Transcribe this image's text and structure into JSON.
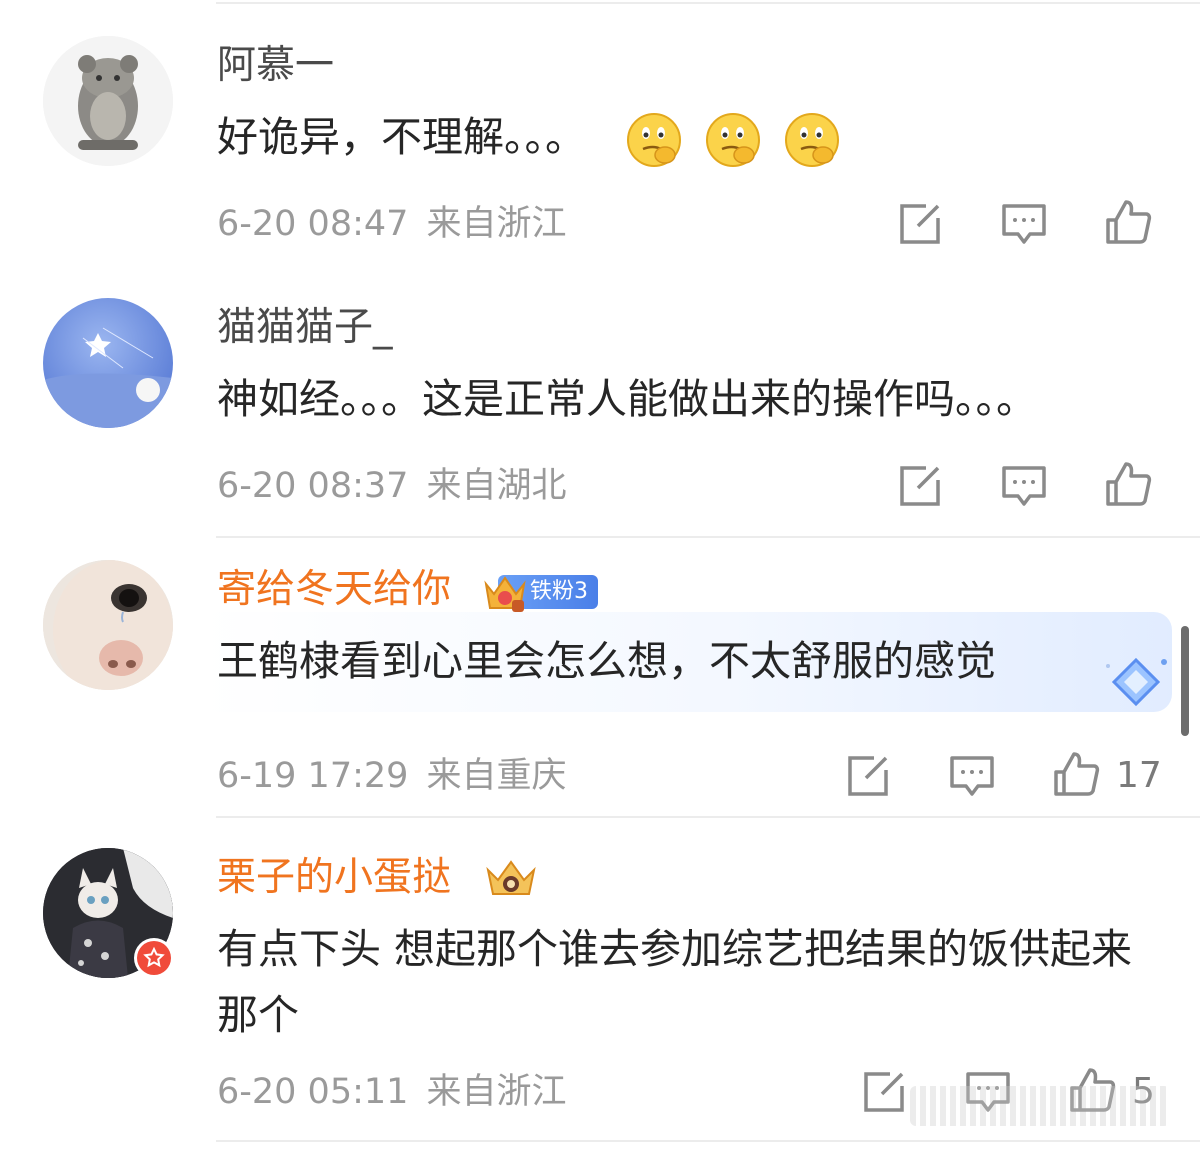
{
  "comments": [
    {
      "username": "阿慕一",
      "text": "好诡异，不理解。。。",
      "emojis": [
        "thinking-face",
        "thinking-face",
        "thinking-face"
      ],
      "date": "6-20 08:47",
      "location": "来自浙江",
      "likes": ""
    },
    {
      "username": "猫猫猫子_",
      "text": "神如经。。。这是正常人能做出来的操作吗。。。",
      "emojis": [],
      "date": "6-20 08:37",
      "location": "来自湖北",
      "likes": ""
    },
    {
      "username": "寄给冬天给你",
      "badge": "铁粉3",
      "text": "王鹤棣看到心里会怎么想，不太舒服的感觉",
      "emojis": [],
      "date": "6-19 17:29",
      "location": "来自重庆",
      "likes": "17"
    },
    {
      "username": "栗子的小蛋挞",
      "text": "有点下头 想起那个谁去参加综艺把结果的饭供起来 那个",
      "emojis": [],
      "date": "6-20 05:11",
      "location": "来自浙江",
      "likes": "5"
    }
  ],
  "colors": {
    "username": "#4a4a4a",
    "vip_username": "#f0741f",
    "meta": "#9a9a9a",
    "icon": "#8a8a8a",
    "fan_badge": "#5a8ef0"
  },
  "icons": [
    "edit-share-icon",
    "comment-icon",
    "thumbs-up-icon",
    "crown-icon",
    "thinking-face-icon"
  ]
}
